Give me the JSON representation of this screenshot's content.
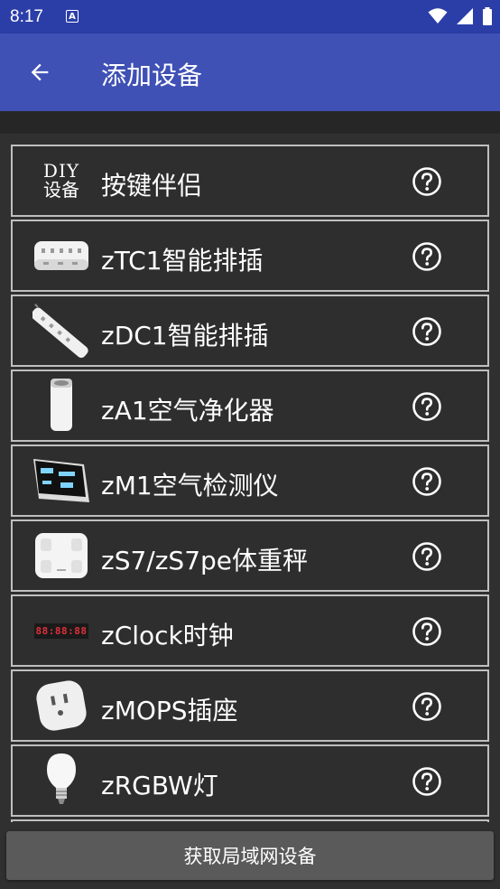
{
  "status_bar": {
    "time": "8:17",
    "notification_icon": "A",
    "icons": [
      "wifi-icon",
      "cellular-icon",
      "battery-icon"
    ]
  },
  "app_bar": {
    "title": "添加设备",
    "back_icon": "arrow-left-icon"
  },
  "devices": [
    {
      "name": "按键伴侣",
      "icon": "diy-icon",
      "icon_text_1": "DIY",
      "icon_text_2": "设备"
    },
    {
      "name": "zTC1智能排插",
      "icon": "power-strip-icon"
    },
    {
      "name": "zDC1智能排插",
      "icon": "long-power-strip-icon"
    },
    {
      "name": "zA1空气净化器",
      "icon": "air-purifier-icon"
    },
    {
      "name": "zM1空气检测仪",
      "icon": "air-monitor-icon"
    },
    {
      "name": "zS7/zS7pe体重秤",
      "icon": "scale-icon"
    },
    {
      "name": "zClock时钟",
      "icon": "clock-icon",
      "icon_text_1": "88:88:88"
    },
    {
      "name": "zMOPS插座",
      "icon": "socket-icon"
    },
    {
      "name": "zRGBW灯",
      "icon": "bulb-icon"
    }
  ],
  "bottom_button": {
    "label": "获取局域网设备"
  },
  "colors": {
    "status_bar": "#2b3ea8",
    "app_bar": "#3f51b5",
    "background": "#303030",
    "item_border": "#bfbfbf",
    "button": "#5a5a5a"
  }
}
